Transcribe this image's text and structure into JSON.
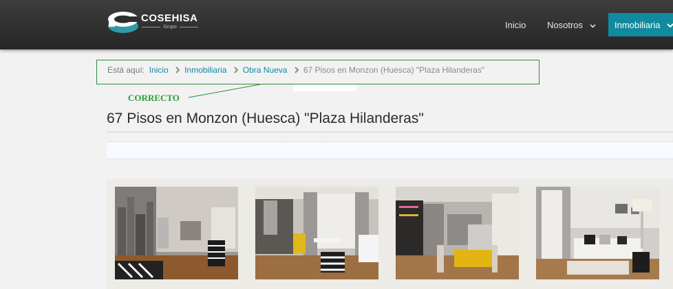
{
  "brand": {
    "name": "COSEHISA",
    "sub": "Grupo",
    "colors": {
      "teal": "#0f8a9e",
      "dark": "#2d2d2d"
    }
  },
  "nav": {
    "items": [
      {
        "label": "Inicio"
      },
      {
        "label": "Nosotros",
        "icon": "chevron-down-icon"
      },
      {
        "label": "Inmobiliaria",
        "icon": "chevron-down-icon",
        "active": true
      }
    ]
  },
  "breadcrumb": {
    "prefix": "Está aquí:",
    "links": [
      "Inicio",
      "Inmobiliaria",
      "Obra Nueva"
    ],
    "current": "67 Pisos en Monzon (Huesca) \"Plaza Hilanderas\"",
    "separator_icon": "chevron-right-icon"
  },
  "annotation": {
    "label": "CORRECTO",
    "color": "#2a9b3b"
  },
  "page": {
    "title": "67 Pisos en Monzon (Huesca) \"Plaza Hilanderas\""
  },
  "gallery": {
    "photos": [
      {
        "name": "gallery-photo-1"
      },
      {
        "name": "gallery-photo-2"
      },
      {
        "name": "gallery-photo-3"
      },
      {
        "name": "gallery-photo-4"
      }
    ]
  }
}
